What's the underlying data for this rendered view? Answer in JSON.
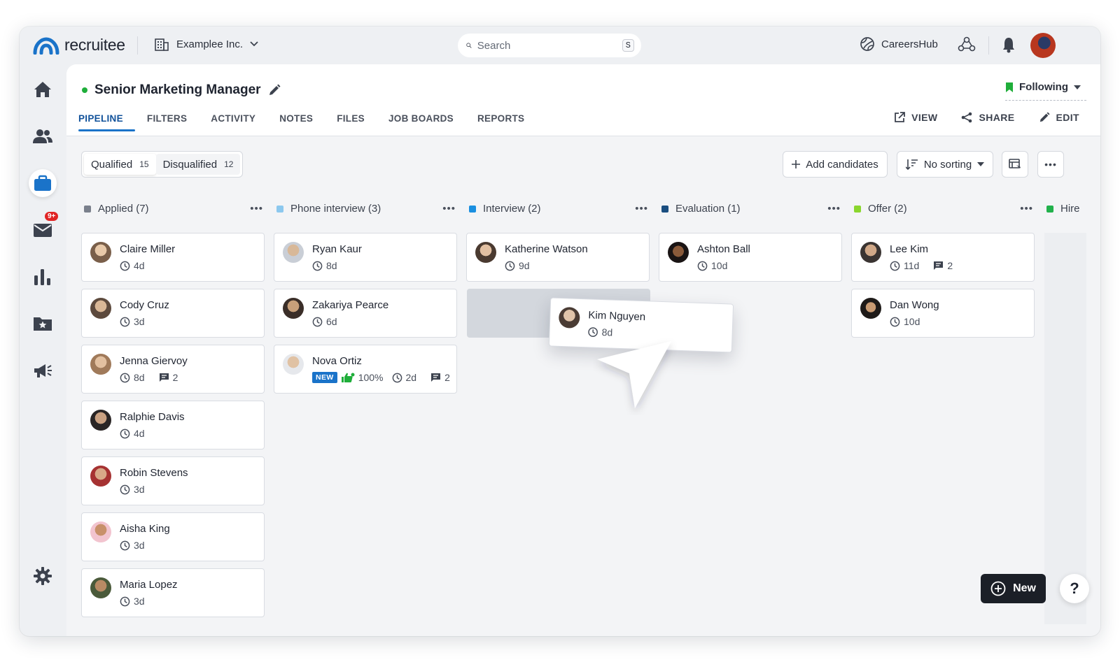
{
  "app": {
    "logo_text": "recruitee",
    "company": "Examplee Inc.",
    "careers": "CareersHub",
    "mail_badge": "9+"
  },
  "search": {
    "placeholder": "Search",
    "shortcut": "S"
  },
  "job": {
    "title": "Senior Marketing Manager",
    "following": "Following",
    "tabs": [
      "PIPELINE",
      "FILTERS",
      "ACTIVITY",
      "NOTES",
      "FILES",
      "JOB BOARDS",
      "REPORTS"
    ],
    "actions": {
      "view": "VIEW",
      "share": "SHARE",
      "edit": "EDIT"
    }
  },
  "toolbar": {
    "qualified_label": "Qualified",
    "qualified_count": "15",
    "disqualified_label": "Disqualified",
    "disqualified_count": "12",
    "add_candidates": "Add candidates",
    "sorting": "No sorting"
  },
  "colors": {
    "applied": "#7a808c",
    "phone": "#8cc8ee",
    "interview": "#1a8fe0",
    "evaluation": "#1a4e80",
    "offer": "#8ad62e",
    "hired": "#22b14c"
  },
  "columns": [
    {
      "label": "Applied (7)",
      "cards": [
        {
          "name": "Claire Miller",
          "time": "4d"
        },
        {
          "name": "Cody Cruz",
          "time": "3d"
        },
        {
          "name": "Jenna Giervoy",
          "time": "8d",
          "comments": "2"
        },
        {
          "name": "Ralphie Davis",
          "time": "4d"
        },
        {
          "name": "Robin Stevens",
          "time": "3d"
        },
        {
          "name": "Aisha King",
          "time": "3d"
        },
        {
          "name": "Maria Lopez",
          "time": "3d"
        }
      ]
    },
    {
      "label": "Phone interview (3)",
      "cards": [
        {
          "name": "Ryan Kaur",
          "time": "8d"
        },
        {
          "name": "Zakariya Pearce",
          "time": "6d"
        },
        {
          "name": "Nova Ortiz",
          "tag": "NEW",
          "score": "100%",
          "time": "2d",
          "comments": "2"
        }
      ]
    },
    {
      "label": "Interview (2)",
      "cards": [
        {
          "name": "Katherine Watson",
          "time": "9d"
        }
      ]
    },
    {
      "label": "Evaluation (1)",
      "cards": [
        {
          "name": "Ashton Ball",
          "time": "10d"
        }
      ]
    },
    {
      "label": "Offer (2)",
      "cards": [
        {
          "name": "Lee Kim",
          "time": "11d",
          "comments": "2"
        },
        {
          "name": "Dan Wong",
          "time": "10d"
        }
      ]
    },
    {
      "label": "Hire"
    }
  ],
  "dragging": {
    "name": "Kim Nguyen",
    "time": "8d"
  },
  "fab": {
    "new": "New",
    "help": "?"
  }
}
